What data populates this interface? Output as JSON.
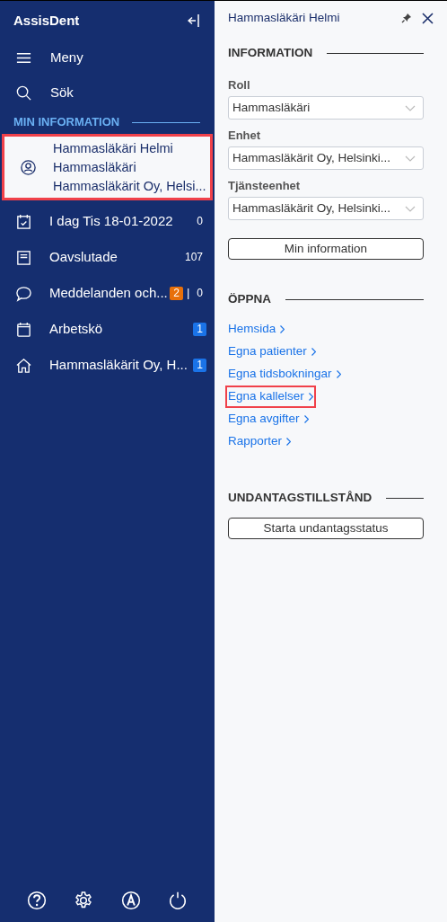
{
  "sidebar": {
    "app_name": "AssisDent",
    "top_items": [
      {
        "label": "Meny"
      },
      {
        "label": "Sök"
      }
    ],
    "section_title": "MIN INFORMATION",
    "user_card": {
      "selected": true,
      "highlighted": true,
      "lines": [
        "Hammasläkäri Helmi",
        "Hammasläkäri",
        "Hammasläkärit Oy, Helsi..."
      ]
    },
    "items": [
      {
        "label": "I dag Tis 18-01-2022",
        "counts": [
          {
            "kind": "plain",
            "text": "0"
          }
        ]
      },
      {
        "label": "Oavslutade",
        "counts": [
          {
            "kind": "plain",
            "text": "107"
          }
        ]
      },
      {
        "label": "Meddelanden och...",
        "counts": [
          {
            "kind": "badge",
            "text": "2",
            "color": "#e8700a"
          },
          {
            "kind": "separator",
            "text": "|"
          },
          {
            "kind": "plain",
            "text": "0"
          }
        ]
      },
      {
        "label": "Arbetskö",
        "counts": [
          {
            "kind": "badge",
            "text": "1",
            "color": "#1a73e8"
          }
        ]
      },
      {
        "label": "Hammasläkärit Oy, H...",
        "counts": [
          {
            "kind": "badge",
            "text": "1",
            "color": "#1a73e8"
          }
        ]
      }
    ]
  },
  "panel": {
    "title": "Hammasläkäri Helmi",
    "information": {
      "title": "INFORMATION",
      "fields": [
        {
          "label": "Roll",
          "value": "Hammasläkäri"
        },
        {
          "label": "Enhet",
          "value": "Hammasläkärit Oy, Helsinki..."
        },
        {
          "label": "Tjänsteenhet",
          "value": "Hammasläkärit Oy, Helsinki..."
        }
      ],
      "button": "Min information"
    },
    "open": {
      "title": "ÖPPNA",
      "links": [
        {
          "label": "Hemsida",
          "highlighted": false
        },
        {
          "label": "Egna patienter",
          "highlighted": false
        },
        {
          "label": "Egna tidsbokningar",
          "highlighted": false
        },
        {
          "label": "Egna kallelser",
          "highlighted": true
        },
        {
          "label": "Egna avgifter",
          "highlighted": false
        },
        {
          "label": "Rapporter",
          "highlighted": false
        }
      ]
    },
    "exception": {
      "title": "UNDANTAGSTILLSTÅND",
      "button": "Starta undantagsstatus"
    }
  }
}
